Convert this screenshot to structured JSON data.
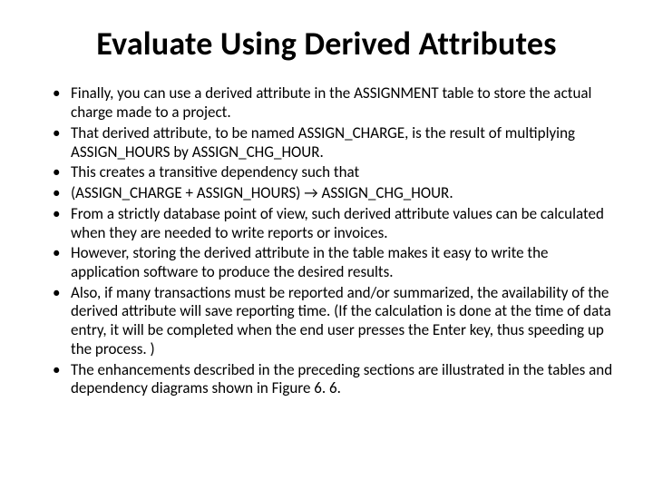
{
  "title": "Evaluate Using Derived Attributes",
  "bullets": [
    "Finally, you can use a derived attribute in the ASSIGNMENT table to store the actual charge made to a project.",
    "That derived attribute, to be named ASSIGN_CHARGE, is the result of multiplying ASSIGN_HOURS by ASSIGN_CHG_HOUR.",
    "This creates a transitive dependency such that",
    "(ASSIGN_CHARGE + ASSIGN_HOURS) → ASSIGN_CHG_HOUR.",
    "From a strictly database point of view, such derived attribute values can be calculated when they are needed to write reports or invoices.",
    " However, storing the derived attribute in the table makes it easy to write the application software to produce the desired results.",
    "Also, if many transactions must be reported and/or summarized, the availability of the derived attribute will save reporting time. (If the calculation is done at the time of data entry, it will be completed when the end user presses the Enter key, thus speeding up the process. )",
    "The enhancements described in the preceding sections are illustrated in the tables and dependency diagrams shown in Figure 6. 6."
  ]
}
